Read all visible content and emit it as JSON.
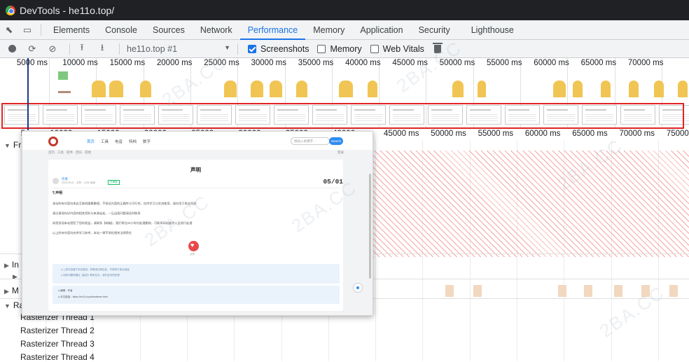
{
  "window": {
    "title": "DevTools - he11o.top/"
  },
  "panel_tabs": [
    {
      "label": "Elements"
    },
    {
      "label": "Console"
    },
    {
      "label": "Sources"
    },
    {
      "label": "Network"
    },
    {
      "label": "Performance"
    },
    {
      "label": "Memory"
    },
    {
      "label": "Application"
    },
    {
      "label": "Security"
    },
    {
      "label": "Lighthouse"
    }
  ],
  "active_tab": "Performance",
  "toolbar": {
    "profile": "he11o.top #1",
    "screenshots_label": "Screenshots",
    "screenshots_checked": true,
    "memory_label": "Memory",
    "memory_checked": false,
    "webvitals_label": "Web Vitals",
    "webvitals_checked": false
  },
  "overview_ticks": [
    "5000 ms",
    "10000 ms",
    "15000 ms",
    "20000 ms",
    "25000 ms",
    "30000 ms",
    "35000 ms",
    "40000 ms",
    "45000 ms",
    "50000 ms",
    "55000 ms",
    "60000 ms",
    "65000 ms",
    "70000 ms",
    "7500"
  ],
  "lower_ticks_partial": [
    "5",
    "10000",
    "15000",
    "20000",
    "25000",
    "30000",
    "35000",
    "40000"
  ],
  "lower_ticks": [
    "45000 ms",
    "50000 ms",
    "55000 ms",
    "60000 ms",
    "65000 ms",
    "70000 ms",
    "75000 ms"
  ],
  "tracks": {
    "frames": "Fr",
    "interactions": "In",
    "main": "M",
    "raster": "Ra",
    "raster_threads": [
      "Rasterizer Thread 1",
      "Rasterizer Thread 2",
      "Rasterizer Thread 3",
      "Rasterizer Thread 4"
    ]
  },
  "preview": {
    "nav": [
      "首页",
      "工具",
      "电音",
      "特档",
      "数字"
    ],
    "search_placeholder": "搜站入关键字...",
    "search_button": "Search",
    "subnav": "首页 · 工具 · 软件 · 音乐 · 其他",
    "login": "登录",
    "post_title": "声明",
    "post_date": "05/01",
    "author": "作者",
    "meta": "2020-05-01 · 文章 · 1,000 阅读",
    "tag": "已审核",
    "section": "¶ 声明",
    "lines": [
      "本站所有内容均来自互联网搜集整理，不保证内容的正确性与可行性，仅供学习与交流使用，请勿用于商业用途",
      "请注意保存好内容的相关资料与来源出处，一旦出现问题请及时联系",
      "如您发现本站侵犯了您的权益，请联系【邮箱】，我们将在24小时内处理删除，可联系网站维护人员进行处理",
      "以上所有内容均仅供学习参考，本站一律不承担相关法律责任"
    ],
    "heart_label": "点赞",
    "notes": [
      "● 上述内容属于本站原创，转载请注明出处，不得用于商业用途",
      "● 如有问题请通过【留言】联系站长，我们会尽快处理"
    ],
    "copy_lines": [
      "● 编辑：作者",
      "● 本文链接：https://he11o.top/disclaimer.html"
    ]
  },
  "watermark_text": "2BA.CC",
  "colors": {
    "accent": "#1a73e8",
    "cpu": "#f1c553",
    "frame_border": "#e02424"
  }
}
